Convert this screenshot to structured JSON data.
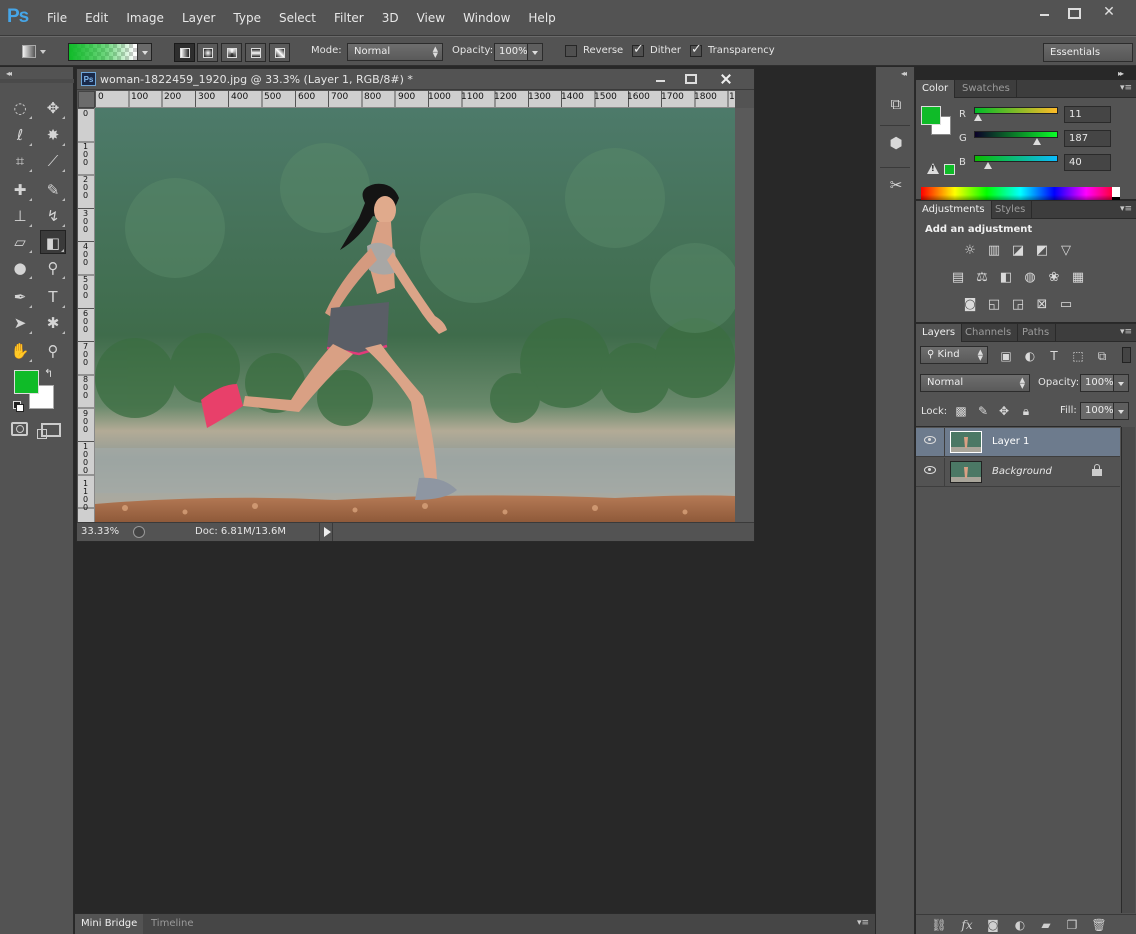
{
  "app": {
    "logo": "Ps",
    "menu": [
      "File",
      "Edit",
      "Image",
      "Layer",
      "Type",
      "Select",
      "Filter",
      "3D",
      "View",
      "Window",
      "Help"
    ]
  },
  "options": {
    "mode_label": "Mode:",
    "mode_value": "Normal",
    "opacity_label": "Opacity:",
    "opacity_value": "100%",
    "reverse_label": "Reverse",
    "reverse_checked": false,
    "dither_label": "Dither",
    "dither_checked": true,
    "transparency_label": "Transparency",
    "transparency_checked": true,
    "workspace": "Essentials",
    "gradient_color": "#0fbb28"
  },
  "document": {
    "title": "woman-1822459_1920.jpg @ 33.3% (Layer 1, RGB/8#) *",
    "ruler_h": [
      "0",
      "100",
      "200",
      "300",
      "400",
      "500",
      "600",
      "700",
      "800",
      "900",
      "1000",
      "1100",
      "1200",
      "1300",
      "1400",
      "1500",
      "1600",
      "1700",
      "1800",
      "1"
    ],
    "ruler_v": [
      "0",
      "1\n0\n0",
      "2\n0\n0",
      "3\n0\n0",
      "4\n0\n0",
      "5\n0\n0",
      "6\n0\n0",
      "7\n0\n0",
      "8\n0\n0",
      "9\n0\n0",
      "1\n0\n0\n0",
      "1\n1\n0\n0"
    ],
    "zoom": "33.33%",
    "doc_size": "Doc: 6.81M/13.6M"
  },
  "bottom_tabs": [
    "Mini Bridge",
    "Timeline"
  ],
  "colors": {
    "foreground": "#0fbb28",
    "background": "#ffffff"
  },
  "color_panel": {
    "tabs": [
      "Color",
      "Swatches"
    ],
    "r_label": "R",
    "r_value": "11",
    "g_label": "G",
    "g_value": "187",
    "b_label": "B",
    "b_value": "40"
  },
  "adjustments_panel": {
    "tabs": [
      "Adjustments",
      "Styles"
    ],
    "title": "Add an adjustment"
  },
  "layers_panel": {
    "tabs": [
      "Layers",
      "Channels",
      "Paths"
    ],
    "kind_label": "Kind",
    "blend_mode": "Normal",
    "opacity_label": "Opacity:",
    "opacity_value": "100%",
    "lock_label": "Lock:",
    "fill_label": "Fill:",
    "fill_value": "100%",
    "layers": [
      {
        "name": "Layer 1",
        "selected": true
      },
      {
        "name": "Background",
        "selected": false,
        "locked": true
      }
    ]
  }
}
